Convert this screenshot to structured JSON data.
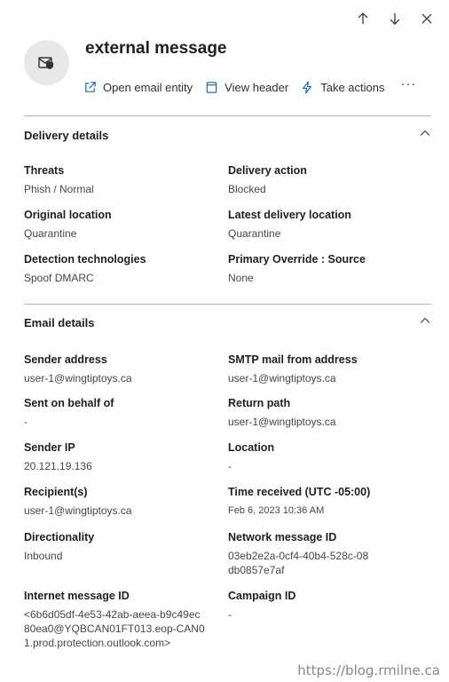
{
  "panel": {
    "title": "external message"
  },
  "actions": {
    "open_email_entity": "Open email entity",
    "view_header": "View header",
    "take_actions": "Take actions",
    "more": "···"
  },
  "delivery_details": {
    "title": "Delivery details",
    "threats_label": "Threats",
    "threats_value": "Phish / Normal",
    "delivery_action_label": "Delivery action",
    "delivery_action_value": "Blocked",
    "original_location_label": "Original location",
    "original_location_value": "Quarantine",
    "latest_delivery_location_label": "Latest delivery location",
    "latest_delivery_location_value": "Quarantine",
    "detection_technologies_label": "Detection technologies",
    "detection_technologies_value": "Spoof DMARC",
    "primary_override_label": "Primary Override : Source",
    "primary_override_value": "None"
  },
  "email_details": {
    "title": "Email details",
    "sender_address_label": "Sender address",
    "sender_address_value": "user-1@wingtiptoys.ca",
    "smtp_mail_from_label": "SMTP mail from address",
    "smtp_mail_from_value": "user-1@wingtiptoys.ca",
    "sent_on_behalf_label": "Sent on behalf of",
    "sent_on_behalf_value": "-",
    "return_path_label": "Return path",
    "return_path_value": "user-1@wingtiptoys.ca",
    "sender_ip_label": "Sender IP",
    "sender_ip_value": "20.121.19.136",
    "location_label": "Location",
    "location_value": "-",
    "recipients_label": "Recipient(s)",
    "recipients_value": "user-1@wingtiptoys.ca",
    "time_received_label": "Time received (UTC -05:00)",
    "time_received_value": "Feb 6, 2023 10:36 AM",
    "directionality_label": "Directionality",
    "directionality_value": "Inbound",
    "network_message_id_label": "Network message ID",
    "network_message_id_value": "03eb2e2a-0cf4-40b4-528c-08db0857e7af",
    "internet_message_id_label": "Internet message ID",
    "internet_message_id_value": "<6b6d05df-4e53-42ab-aeea-b9c49ec80ea0@YQBCAN01FT013.eop-CAN01.prod.protection.outlook.com>",
    "campaign_id_label": "Campaign ID",
    "campaign_id_value": "-"
  },
  "watermark": "https://blog.rmilne.ca",
  "colors": {
    "accent": "#0f6cbd",
    "divider": "#b8b6b4",
    "avatar_bg": "#e9e8e7"
  }
}
